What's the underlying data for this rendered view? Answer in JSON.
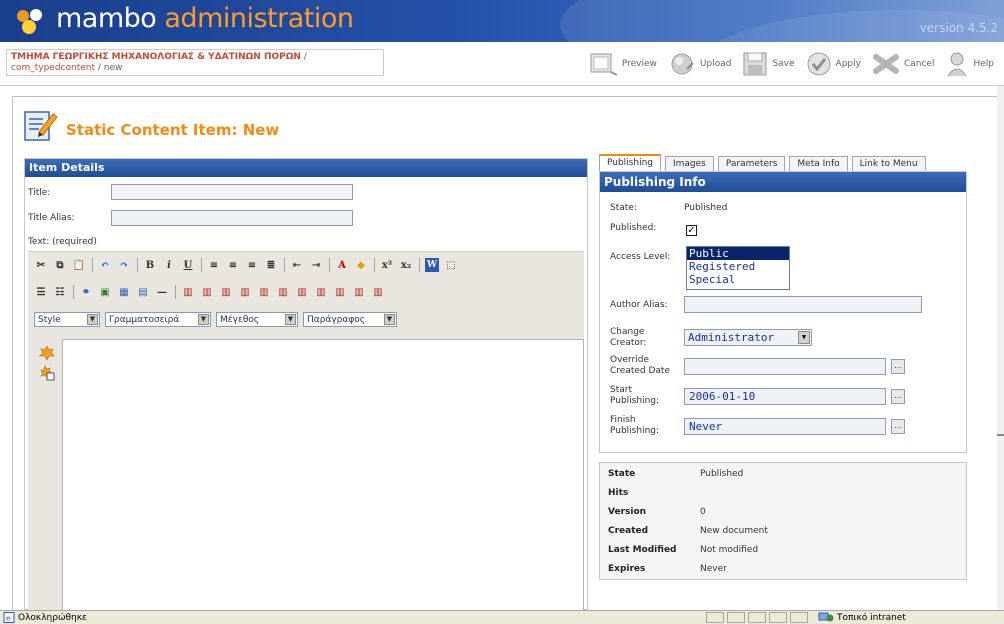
{
  "header": {
    "brand_main": "mambo ",
    "brand_accent": "administration",
    "version": "version 4.5.2"
  },
  "pathway": {
    "site": "ΤΜΗΜΑ ΓΕΩΡΓΙΚΗΣ ΜΗΧΑΝΟΛΟΓΙΑΣ & ΥΔΑΤΙΝΩΝ ΠΟΡΩΝ",
    "sep": " /",
    "component": "com_typedcontent",
    "task": " / new"
  },
  "toolbar": {
    "preview": "Preview",
    "upload": "Upload",
    "save": "Save",
    "apply": "Apply",
    "cancel": "Cancel",
    "help": "Help"
  },
  "page": {
    "title": "Static Content Item: New"
  },
  "item_details": {
    "heading": "Item Details",
    "title_label": "Title:",
    "title_value": "",
    "alias_label": "Title Alias:",
    "alias_value": "",
    "text_label": "Text: (required)"
  },
  "editor": {
    "style_select": "Style",
    "font_select": "Γραμματοσειρά",
    "size_select": "Μέγεθος",
    "format_select": "Παράγραφος"
  },
  "tabs": [
    "Publishing",
    "Images",
    "Parameters",
    "Meta Info",
    "Link to Menu"
  ],
  "publishing": {
    "heading": "Publishing Info",
    "state_label": "State:",
    "state_value": "Published",
    "published_label": "Published:",
    "published_checked": true,
    "access_label": "Access Level:",
    "access_options": [
      "Public",
      "Registered",
      "Special"
    ],
    "access_selected": "Public",
    "author_alias_label": "Author Alias:",
    "author_alias_value": "",
    "change_creator_label_1": "Change",
    "change_creator_label_2": "Creator:",
    "change_creator_value": "Administrator",
    "override_label_1": "Override",
    "override_label_2": "Created Date",
    "override_value": "",
    "start_label_1": "Start",
    "start_label_2": "Publishing:",
    "start_value": "2006-01-10",
    "finish_label_1": "Finish",
    "finish_label_2": "Publishing:",
    "finish_value": "Never",
    "dots": "..."
  },
  "info": [
    {
      "key": "State",
      "value": "Published"
    },
    {
      "key": "Hits",
      "value": ""
    },
    {
      "key": "Version",
      "value": "0"
    },
    {
      "key": "Created",
      "value": "New document"
    },
    {
      "key": "Last Modified",
      "value": "Not modified"
    },
    {
      "key": "Expires",
      "value": "Never"
    }
  ],
  "statusbar": {
    "left_text": "Ολοκληρώθηκε",
    "zone_text": "Τοπικό intranet"
  },
  "colors": {
    "banner_dark": "#1a3f8c",
    "accent_orange": "#f28a14",
    "panel_head": "#1f4d98",
    "path_red": "#c64934"
  }
}
